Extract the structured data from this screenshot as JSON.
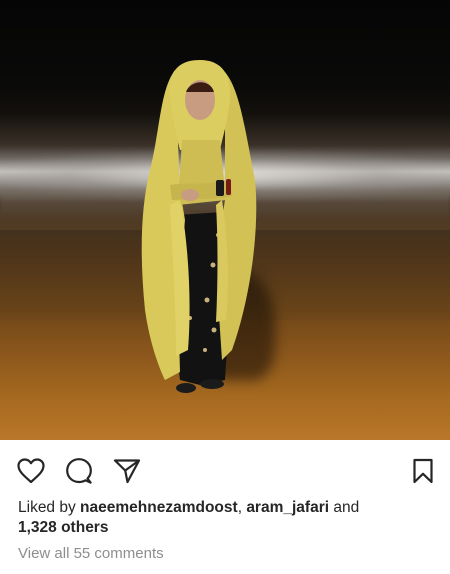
{
  "post": {
    "photo_alt": "",
    "actions": {
      "like_icon": "heart-icon",
      "comment_icon": "comment-icon",
      "share_icon": "paper-plane-icon",
      "save_icon": "bookmark-icon"
    },
    "likes": {
      "prefix": "Liked by ",
      "user1": "naeemehnezamdoost",
      "separator": ", ",
      "user2": "aram_jafari",
      "and": " and",
      "others": "1,328 others"
    },
    "comments_link": "View all 55 comments"
  },
  "colors": {
    "text": "#262626",
    "muted": "#8e8e8e",
    "scarf": "#d8c95a"
  }
}
